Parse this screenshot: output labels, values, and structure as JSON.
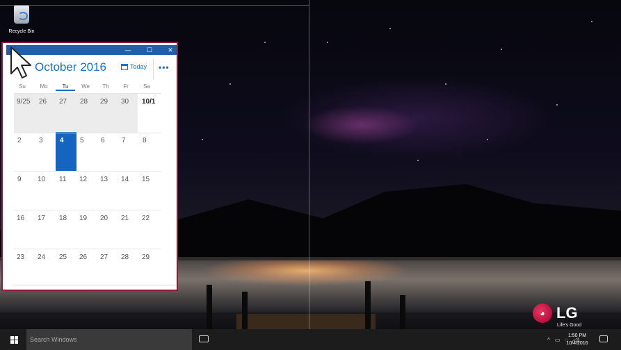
{
  "desktop": {
    "recycle_bin_label": "Recycle Bin",
    "brand_name": "LG",
    "brand_slogan": "Life's Good"
  },
  "calendar": {
    "window_controls": {
      "minimize": "—",
      "maximize": "☐",
      "close": "✕"
    },
    "month_title": "October 2016",
    "today_label": "Today",
    "more_label": "•••",
    "weekdays": [
      "Su",
      "Mo",
      "Tu",
      "We",
      "Th",
      "Fr",
      "Sa"
    ],
    "active_weekday": "Tu",
    "weeks": [
      [
        "9/25",
        "26",
        "27",
        "28",
        "29",
        "30",
        "10/1"
      ],
      [
        "2",
        "3",
        "4",
        "5",
        "6",
        "7",
        "8"
      ],
      [
        "9",
        "10",
        "11",
        "12",
        "13",
        "14",
        "15"
      ],
      [
        "16",
        "17",
        "18",
        "19",
        "20",
        "21",
        "22"
      ],
      [
        "23",
        "24",
        "25",
        "26",
        "27",
        "28",
        "29"
      ]
    ],
    "selected_day": "4"
  },
  "taskbar": {
    "search_placeholder": "Search Windows",
    "time": "1:50 PM",
    "date": "10/4/2016",
    "tray_chevron": "^"
  },
  "colors": {
    "accent": "#1a73c9",
    "selected_day": "#1565c0",
    "highlight_border": "#8c1c3b",
    "titlebar": "#1f5ea9",
    "taskbar": "#1c1c1c"
  }
}
